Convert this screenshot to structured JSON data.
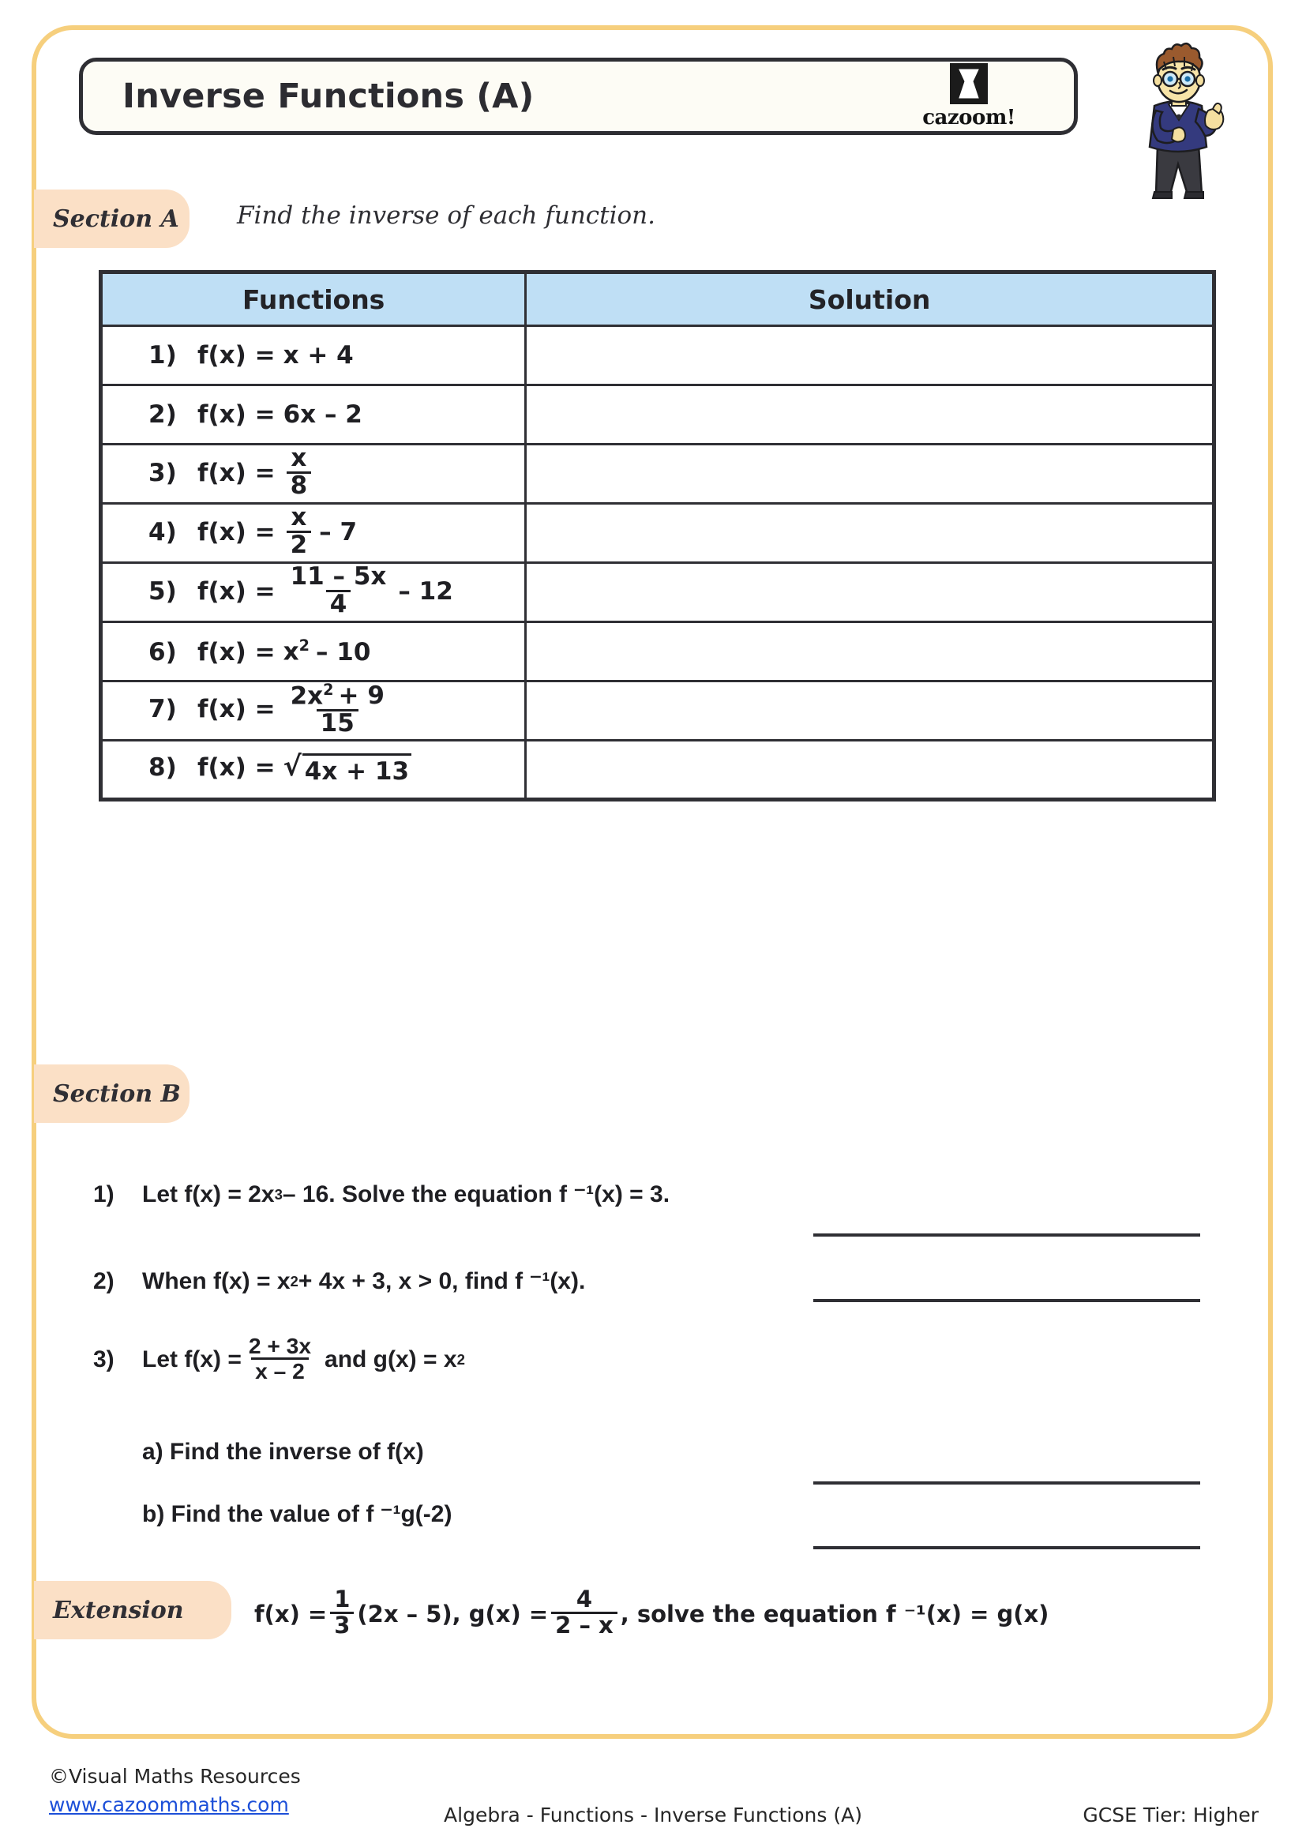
{
  "worksheet": {
    "title": "Inverse Functions (A)",
    "logo_word": "cazoom!",
    "logo_icon": "hourglass-icon",
    "mascot_icon": "student-mascot"
  },
  "section_a": {
    "tag": "Section A",
    "instruction": "Find the inverse of each function.",
    "columns": [
      "Functions",
      "Solution"
    ],
    "rows": [
      {
        "index": "1)",
        "fn_plain": "f(x) = x + 4",
        "lhs": "f(x) =",
        "type": "plain",
        "expr": "x + 4"
      },
      {
        "index": "2)",
        "fn_plain": "f(x) = 6x – 2",
        "lhs": "f(x) =",
        "type": "plain",
        "expr": "6x – 2"
      },
      {
        "index": "3)",
        "fn_plain": "f(x) = x/8",
        "lhs": "f(x) =",
        "type": "fraction",
        "num": "x",
        "den": "8",
        "tail": ""
      },
      {
        "index": "4)",
        "fn_plain": "f(x) = x/2 – 7",
        "lhs": "f(x) =",
        "type": "fraction",
        "num": "x",
        "den": "2",
        "tail": "– 7"
      },
      {
        "index": "5)",
        "fn_plain": "f(x) = (11 – 5x)/4 – 12",
        "lhs": "f(x) =",
        "type": "fraction",
        "num": "11 – 5x",
        "den": "4",
        "tail": "– 12"
      },
      {
        "index": "6)",
        "fn_plain": "f(x) = x² – 10",
        "lhs": "f(x) =",
        "type": "power",
        "base": "x",
        "exp": "2",
        "tail": "– 10"
      },
      {
        "index": "7)",
        "fn_plain": "f(x) = (2x² + 9)/15",
        "lhs": "f(x) =",
        "type": "fraction_power",
        "num_base": "2x",
        "num_exp": "2",
        "num_tail": "+ 9",
        "den": "15",
        "tail": ""
      },
      {
        "index": "8)",
        "fn_plain": "f(x) = √(4x + 13)",
        "lhs": "f(x) =",
        "type": "sqrt",
        "radicand": "4x + 13"
      }
    ]
  },
  "section_b": {
    "tag": "Section B",
    "questions": [
      {
        "index": "1)",
        "text_before": "Let f(x) = 2x",
        "exp": "3",
        "text_after": " – 16. Solve the equation f ⁻¹(x) = 3."
      },
      {
        "index": "2)",
        "text_before": "When f(x) = x",
        "exp": "2",
        "text_after": " + 4x + 3, x > 0, find f ⁻¹(x)."
      },
      {
        "index": "3)",
        "text_before": "Let f(x) =",
        "frac_num": "2 + 3x",
        "frac_den": "x – 2",
        "text_mid": "and  g(x) = x",
        "exp": "2",
        "text_after": ""
      }
    ],
    "sub_questions": [
      {
        "label": "a) Find the inverse of  f(x)"
      },
      {
        "label": "b) Find the value of f ⁻¹g(-2)"
      }
    ]
  },
  "extension": {
    "tag": "Extension",
    "part1": "f(x) =",
    "frac1_num": "1",
    "frac1_den": "3",
    "part2": "(2x – 5), g(x) =",
    "frac2_num": "4",
    "frac2_den": "2 – x",
    "part3": ",  solve the equation f ⁻¹(x) = g(x)"
  },
  "footer": {
    "copyright": "©Visual Maths Resources",
    "website": "www.cazoommaths.com",
    "center": "Algebra - Functions - Inverse Functions (A)",
    "right": "GCSE Tier: Higher"
  },
  "colors": {
    "frame": "#f6cf7d",
    "tag_bg": "#fbe0c6",
    "table_header": "#bfdff5",
    "ink": "#2f2f34",
    "link": "#1c4fd8"
  }
}
